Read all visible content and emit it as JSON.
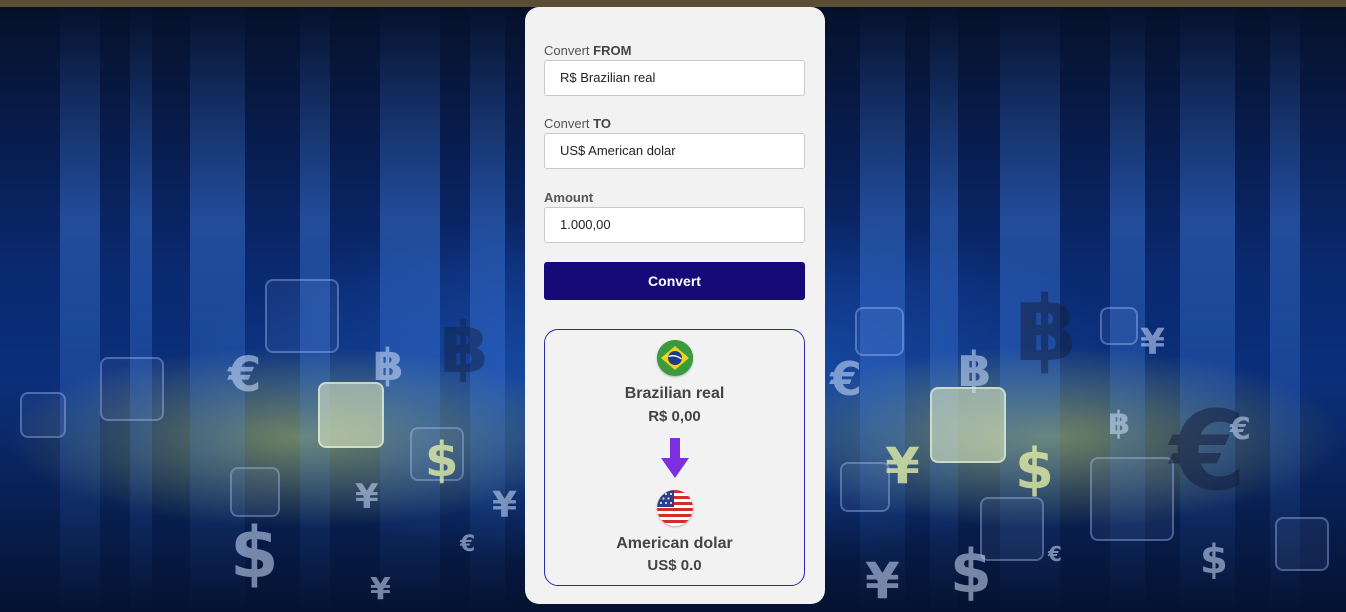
{
  "form": {
    "from_label_prefix": "Convert ",
    "from_label_strong": "FROM",
    "from_value": "R$ Brazilian real",
    "to_label_prefix": "Convert ",
    "to_label_strong": "TO",
    "to_value": "US$ American dolar",
    "amount_label": "Amount",
    "amount_value": "1.000,00",
    "convert_button": "Convert"
  },
  "result": {
    "from_currency_name": "Brazilian real",
    "from_amount": "R$ 0,00",
    "to_currency_name": "American dolar",
    "to_amount": "US$ 0.0"
  },
  "icons": {
    "from_flag": "brazil-flag-icon",
    "arrow": "arrow-down-icon",
    "to_flag": "usa-flag-icon"
  },
  "colors": {
    "button": "#150a78",
    "result_border": "#2a2aa8",
    "arrow": "#7b2fe0"
  }
}
